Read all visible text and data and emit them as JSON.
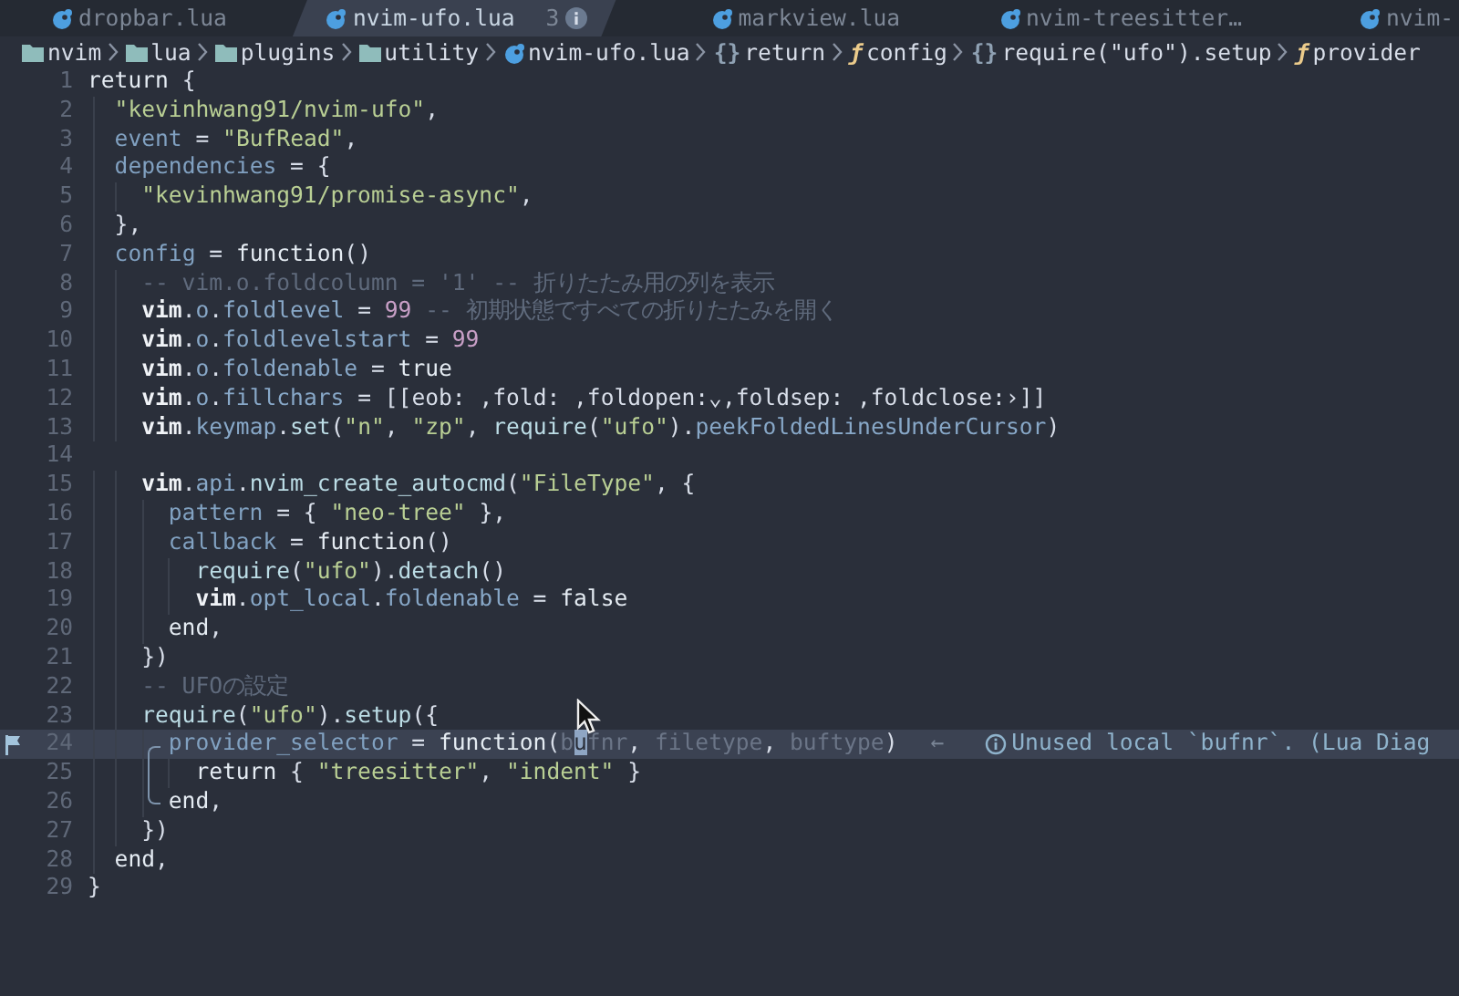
{
  "tabs": [
    {
      "label": "dropbar.lua",
      "selected": false
    },
    {
      "label": "nvim-ufo.lua",
      "selected": true,
      "badge": "3"
    },
    {
      "label": "markview.lua",
      "selected": false
    },
    {
      "label": "nvim-treesitter…",
      "selected": false
    },
    {
      "label": "nvim-",
      "selected": false
    }
  ],
  "breadcrumb": [
    {
      "kind": "folder",
      "text": "nvim"
    },
    {
      "kind": "folder",
      "text": "lua"
    },
    {
      "kind": "folder",
      "text": "plugins"
    },
    {
      "kind": "folder",
      "text": "utility"
    },
    {
      "kind": "file",
      "text": "nvim-ufo.lua"
    },
    {
      "kind": "symbol",
      "symbol": "{}",
      "text": "return"
    },
    {
      "kind": "symbol",
      "symbol": "ƒ",
      "text": "config"
    },
    {
      "kind": "symbol",
      "symbol": "{}",
      "text": "require(\"ufo\").setup"
    },
    {
      "kind": "symbol",
      "symbol": "ƒ",
      "text": "provider"
    }
  ],
  "lines": [
    {
      "number": "1",
      "tokens": [
        {
          "text": "return",
          "kind": "kw"
        },
        {
          "text": " {",
          "kind": "p"
        }
      ]
    },
    {
      "number": "2",
      "tokens": [
        {
          "text": "  \"kevinhwang91/nvim-ufo\"",
          "kind": "str"
        },
        {
          "text": ",",
          "kind": "p"
        }
      ]
    },
    {
      "number": "3",
      "tokens": [
        {
          "text": "  event",
          "kind": "field"
        },
        {
          "text": " = ",
          "kind": "p"
        },
        {
          "text": "\"BufRead\"",
          "kind": "str"
        },
        {
          "text": ",",
          "kind": "p"
        }
      ]
    },
    {
      "number": "4",
      "tokens": [
        {
          "text": "  dependencies",
          "kind": "field"
        },
        {
          "text": " = {",
          "kind": "p"
        }
      ]
    },
    {
      "number": "5",
      "tokens": [
        {
          "text": "    \"kevinhwang91/promise-async\"",
          "kind": "str"
        },
        {
          "text": ",",
          "kind": "p"
        }
      ]
    },
    {
      "number": "6",
      "tokens": [
        {
          "text": "  },",
          "kind": "p"
        }
      ]
    },
    {
      "number": "7",
      "tokens": [
        {
          "text": "  config",
          "kind": "field"
        },
        {
          "text": " = ",
          "kind": "p"
        },
        {
          "text": "function",
          "kind": "kw"
        },
        {
          "text": "()",
          "kind": "p"
        }
      ]
    },
    {
      "number": "8",
      "tokens": [
        {
          "text": "    -- vim.o.foldcolumn = '1' -- 折りたたみ用の列を表示",
          "kind": "comment"
        }
      ]
    },
    {
      "number": "9",
      "tokens": [
        {
          "text": "    vim",
          "kind": "vim"
        },
        {
          "text": ".",
          "kind": "p"
        },
        {
          "text": "o",
          "kind": "prop"
        },
        {
          "text": ".",
          "kind": "p"
        },
        {
          "text": "foldlevel",
          "kind": "prop"
        },
        {
          "text": " = ",
          "kind": "p"
        },
        {
          "text": "99",
          "kind": "num"
        },
        {
          "text": " -- 初期状態ですべての折りたたみを開く",
          "kind": "comment"
        }
      ]
    },
    {
      "number": "10",
      "tokens": [
        {
          "text": "    vim",
          "kind": "vim"
        },
        {
          "text": ".",
          "kind": "p"
        },
        {
          "text": "o",
          "kind": "prop"
        },
        {
          "text": ".",
          "kind": "p"
        },
        {
          "text": "foldlevelstart",
          "kind": "prop"
        },
        {
          "text": " = ",
          "kind": "p"
        },
        {
          "text": "99",
          "kind": "num"
        }
      ]
    },
    {
      "number": "11",
      "tokens": [
        {
          "text": "    vim",
          "kind": "vim"
        },
        {
          "text": ".",
          "kind": "p"
        },
        {
          "text": "o",
          "kind": "prop"
        },
        {
          "text": ".",
          "kind": "p"
        },
        {
          "text": "foldenable",
          "kind": "prop"
        },
        {
          "text": " = ",
          "kind": "p"
        },
        {
          "text": "true",
          "kind": "kw"
        }
      ]
    },
    {
      "number": "12",
      "tokens": [
        {
          "text": "    vim",
          "kind": "vim"
        },
        {
          "text": ".",
          "kind": "p"
        },
        {
          "text": "o",
          "kind": "prop"
        },
        {
          "text": ".",
          "kind": "p"
        },
        {
          "text": "fillchars",
          "kind": "prop"
        },
        {
          "text": " = [[eob: ,fold: ,foldopen:⌄,foldsep: ,foldclose:›]]",
          "kind": "p"
        }
      ]
    },
    {
      "number": "13",
      "tokens": [
        {
          "text": "    vim",
          "kind": "vim"
        },
        {
          "text": ".",
          "kind": "p"
        },
        {
          "text": "keymap",
          "kind": "prop"
        },
        {
          "text": ".",
          "kind": "p"
        },
        {
          "text": "set",
          "kind": "fn"
        },
        {
          "text": "(",
          "kind": "p"
        },
        {
          "text": "\"n\"",
          "kind": "str"
        },
        {
          "text": ", ",
          "kind": "p"
        },
        {
          "text": "\"zp\"",
          "kind": "str"
        },
        {
          "text": ", ",
          "kind": "p"
        },
        {
          "text": "require",
          "kind": "fn"
        },
        {
          "text": "(",
          "kind": "p"
        },
        {
          "text": "\"ufo\"",
          "kind": "str"
        },
        {
          "text": ").",
          "kind": "p"
        },
        {
          "text": "peekFoldedLinesUnderCursor",
          "kind": "prop"
        },
        {
          "text": ")",
          "kind": "p"
        }
      ]
    },
    {
      "number": "14"
    },
    {
      "number": "15",
      "tokens": [
        {
          "text": "    vim",
          "kind": "vim"
        },
        {
          "text": ".",
          "kind": "p"
        },
        {
          "text": "api",
          "kind": "prop"
        },
        {
          "text": ".",
          "kind": "p"
        },
        {
          "text": "nvim_create_autocmd",
          "kind": "fn"
        },
        {
          "text": "(",
          "kind": "p"
        },
        {
          "text": "\"FileType\"",
          "kind": "str"
        },
        {
          "text": ", {",
          "kind": "p"
        }
      ]
    },
    {
      "number": "16",
      "tokens": [
        {
          "text": "      pattern",
          "kind": "field"
        },
        {
          "text": " = { ",
          "kind": "p"
        },
        {
          "text": "\"neo-tree\"",
          "kind": "str"
        },
        {
          "text": " },",
          "kind": "p"
        }
      ]
    },
    {
      "number": "17",
      "tokens": [
        {
          "text": "      callback",
          "kind": "field"
        },
        {
          "text": " = ",
          "kind": "p"
        },
        {
          "text": "function",
          "kind": "kw"
        },
        {
          "text": "()",
          "kind": "p"
        }
      ]
    },
    {
      "number": "18",
      "tokens": [
        {
          "text": "        require",
          "kind": "fn"
        },
        {
          "text": "(",
          "kind": "p"
        },
        {
          "text": "\"ufo\"",
          "kind": "str"
        },
        {
          "text": ").",
          "kind": "p"
        },
        {
          "text": "detach",
          "kind": "fn"
        },
        {
          "text": "()",
          "kind": "p"
        }
      ]
    },
    {
      "number": "19",
      "tokens": [
        {
          "text": "        vim",
          "kind": "vim"
        },
        {
          "text": ".",
          "kind": "p"
        },
        {
          "text": "opt_local",
          "kind": "prop"
        },
        {
          "text": ".",
          "kind": "p"
        },
        {
          "text": "foldenable",
          "kind": "prop"
        },
        {
          "text": " = ",
          "kind": "p"
        },
        {
          "text": "false",
          "kind": "kw"
        }
      ]
    },
    {
      "number": "20",
      "tokens": [
        {
          "text": "      end",
          "kind": "kw"
        },
        {
          "text": ",",
          "kind": "p"
        }
      ]
    },
    {
      "number": "21",
      "tokens": [
        {
          "text": "    })",
          "kind": "p"
        }
      ]
    },
    {
      "number": "22",
      "tokens": [
        {
          "text": "    -- UFOの設定",
          "kind": "comment"
        }
      ]
    },
    {
      "number": "23",
      "tokens": [
        {
          "text": "    require",
          "kind": "fn"
        },
        {
          "text": "(",
          "kind": "p"
        },
        {
          "text": "\"ufo\"",
          "kind": "str"
        },
        {
          "text": ").",
          "kind": "p"
        },
        {
          "text": "setup",
          "kind": "fn"
        },
        {
          "text": "({",
          "kind": "p"
        }
      ]
    },
    {
      "number": "24",
      "cursor_line": true,
      "flagged": true,
      "tokens": [
        {
          "text": "      provider_selector",
          "kind": "field"
        },
        {
          "text": " = ",
          "kind": "p"
        },
        {
          "text": "function",
          "kind": "kw"
        },
        {
          "text": "(",
          "kind": "p"
        },
        {
          "text": "b",
          "kind": "unused"
        },
        {
          "text": "u",
          "kind": "unused",
          "cursor": true
        },
        {
          "text": "fnr",
          "kind": "unused"
        },
        {
          "text": ", ",
          "kind": "p"
        },
        {
          "text": "filetype",
          "kind": "unused"
        },
        {
          "text": ", ",
          "kind": "p"
        },
        {
          "text": "buftype",
          "kind": "unused"
        },
        {
          "text": ")",
          "kind": "p"
        }
      ],
      "diagnostic": {
        "arrow": "←",
        "text": "Unused local `bufnr`. (Lua Diag"
      }
    },
    {
      "number": "25",
      "tokens": [
        {
          "text": "        return",
          "kind": "kw"
        },
        {
          "text": " { ",
          "kind": "p"
        },
        {
          "text": "\"treesitter\"",
          "kind": "str"
        },
        {
          "text": ", ",
          "kind": "p"
        },
        {
          "text": "\"indent\"",
          "kind": "str"
        },
        {
          "text": " }",
          "kind": "p"
        }
      ]
    },
    {
      "number": "26",
      "tokens": [
        {
          "text": "      end",
          "kind": "kw"
        },
        {
          "text": ",",
          "kind": "p"
        }
      ]
    },
    {
      "number": "27",
      "tokens": [
        {
          "text": "    })",
          "kind": "p"
        }
      ]
    },
    {
      "number": "28",
      "tokens": [
        {
          "text": "  end",
          "kind": "kw"
        },
        {
          "text": ",",
          "kind": "p"
        }
      ]
    },
    {
      "number": "29",
      "tokens": [
        {
          "text": "}",
          "kind": "p"
        }
      ]
    }
  ]
}
